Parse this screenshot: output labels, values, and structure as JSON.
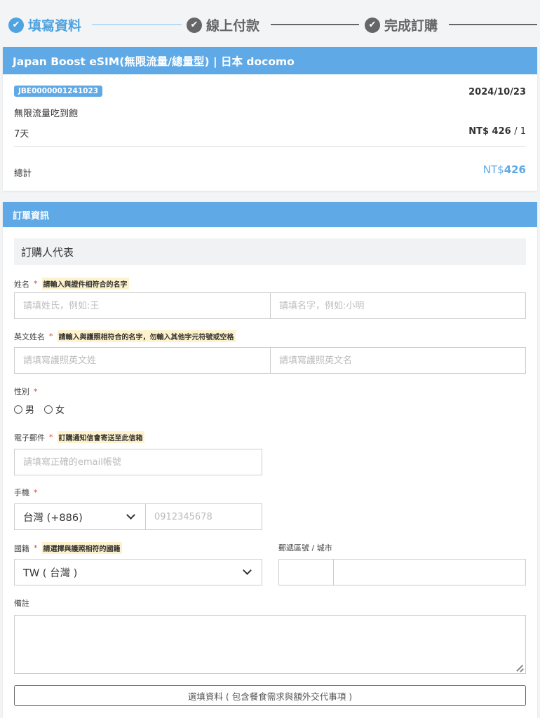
{
  "stepper": {
    "steps": [
      {
        "label": "填寫資料",
        "state": "active"
      },
      {
        "label": "線上付款",
        "state": "inactive"
      },
      {
        "label": "完成訂購",
        "state": "inactive"
      }
    ],
    "check_glyph": "✔"
  },
  "product": {
    "title": "Japan Boost eSIM(無限流量/總量型) | 日本 docomo",
    "order_code": "JBE0000001241023",
    "date": "2024/10/23",
    "plan": "無限流量吃到飽",
    "days": "7天",
    "price": "NT$ 426",
    "quantity": "/ 1",
    "total_label": "總計",
    "total_currency": "NT$",
    "total_value": "426"
  },
  "order": {
    "header": "訂單資訊",
    "section_title": "訂購人代表",
    "required_mark": "*",
    "name": {
      "label": "姓名",
      "hint": "請輸入與證件相符合的名字",
      "last_placeholder": "請填姓氏，例如:王",
      "first_placeholder": "請填名字，例如:小明"
    },
    "english_name": {
      "label": "英文姓名",
      "hint": "請輸入與護照相符合的名字，勿輸入其他字元符號或空格",
      "last_placeholder": "請填寫護照英文姓",
      "first_placeholder": "請填寫護照英文名"
    },
    "gender": {
      "label": "性別",
      "options": [
        "男",
        "女"
      ]
    },
    "email": {
      "label": "電子郵件",
      "hint": "訂購通知信會寄送至此信箱",
      "placeholder": "請填寫正確的email帳號"
    },
    "phone": {
      "label": "手機",
      "country_code": "台灣 (+886)",
      "placeholder": "0912345678"
    },
    "nationality": {
      "label": "國籍",
      "hint": "請選擇與護照相符的國籍",
      "value": "TW ( 台灣 )"
    },
    "postal": {
      "label": "郵遞區號 / 城市"
    },
    "notes": {
      "label": "備註"
    },
    "optional_button": "選填資料 ( 包含餐食需求與額外交代事項 )"
  }
}
